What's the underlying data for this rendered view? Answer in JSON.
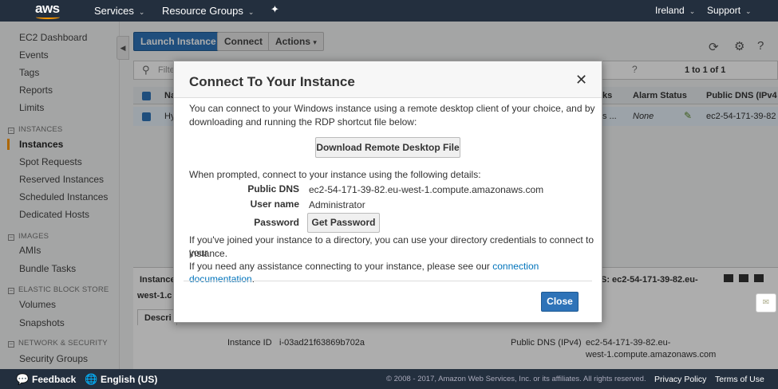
{
  "topnav": {
    "logo": "aws",
    "services": "Services",
    "resource_groups": "Resource Groups",
    "pin_icon": "pin-icon",
    "region": "Ireland",
    "support": "Support"
  },
  "sidebar": {
    "items": [
      "EC2 Dashboard",
      "Events",
      "Tags",
      "Reports",
      "Limits"
    ],
    "sections": [
      {
        "title": "INSTANCES",
        "items": [
          "Instances",
          "Spot Requests",
          "Reserved Instances",
          "Scheduled Instances",
          "Dedicated Hosts"
        ]
      },
      {
        "title": "IMAGES",
        "items": [
          "AMIs",
          "Bundle Tasks"
        ]
      },
      {
        "title": "ELASTIC BLOCK STORE",
        "items": [
          "Volumes",
          "Snapshots"
        ]
      },
      {
        "title": "NETWORK & SECURITY",
        "items": [
          "Security Groups"
        ]
      }
    ],
    "active": "Instances"
  },
  "toolbar": {
    "launch": "Launch Instance",
    "connect": "Connect",
    "actions": "Actions"
  },
  "grid": {
    "filter_placeholder": "Filter",
    "pagination": "1 to 1 of 1",
    "headers": {
      "name": "Na",
      "checks": "ks",
      "alarm": "Alarm Status",
      "dns": "Public DNS (IPv4"
    },
    "row": {
      "name": "Hy",
      "checks": "s ...",
      "alarm": "None",
      "dns": "ec2-54-171-39-82"
    }
  },
  "lower": {
    "instance_label": "Instance",
    "instance_suffix": "west-1.c",
    "dns_label": "S: ec2-54-171-39-82.eu-",
    "tab": "Descri",
    "instance_id_label": "Instance ID",
    "instance_id": "i-03ad21f63869b702a",
    "dns_ipv4_label": "Public DNS (IPv4)",
    "dns_line1": "ec2-54-171-39-82.eu-",
    "dns_line2": "west-1.compute.amazonaws.com"
  },
  "modal": {
    "title": "Connect To Your Instance",
    "intro_line1": "You can connect to your Windows instance using a remote desktop client of your choice, and by",
    "intro_line2": "downloading and running the RDP shortcut file below:",
    "download_button": "Download Remote Desktop File",
    "prompt": "When prompted, connect to your instance using the following details:",
    "public_dns_label": "Public DNS",
    "public_dns": "ec2-54-171-39-82.eu-west-1.compute.amazonaws.com",
    "username_label": "User name",
    "username": "Administrator",
    "password_label": "Password",
    "get_password_button": "Get Password",
    "directory_line1": "If you've joined your instance to a directory, you can use your directory credentials to connect to your",
    "directory_line2": "instance.",
    "assist_prefix": "If you need any assistance connecting to your instance, please see our",
    "assist_link": "connection documentation",
    "assist_suffix": ".",
    "close_button": "Close"
  },
  "footer": {
    "feedback": "Feedback",
    "language": "English (US)",
    "copyright": "© 2008 - 2017, Amazon Web Services, Inc. or its affiliates. All rights reserved.",
    "privacy": "Privacy Policy",
    "terms": "Terms of Use"
  },
  "colors": {
    "nav_bg": "#232f3e",
    "accent": "#f90",
    "primary": "#2e73b8",
    "link": "#0073bb"
  }
}
